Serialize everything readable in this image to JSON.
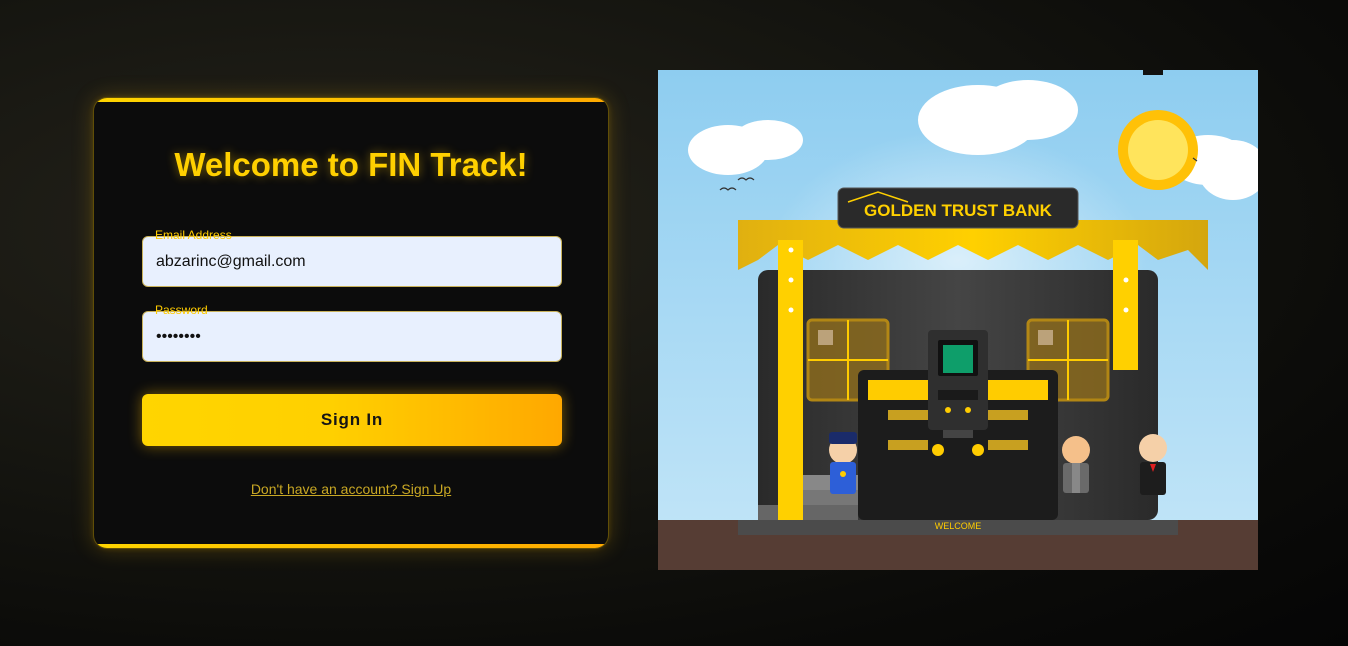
{
  "login": {
    "title": "Welcome to FIN Track!",
    "email_label": "Email Address",
    "email_value": "abzarinc@gmail.com",
    "password_label": "Password",
    "password_value": "••••••••",
    "signin_label": "Sign In",
    "signup_link": "Don't have an account? Sign Up"
  },
  "illustration": {
    "bank_sign": "GOLDEN TRUST BANK",
    "doormat": "WELCOME"
  },
  "colors": {
    "accent": "#ffd000",
    "accent_end": "#ffa800",
    "card_bg": "#0c0c0c",
    "input_bg": "#e8f0fe"
  }
}
